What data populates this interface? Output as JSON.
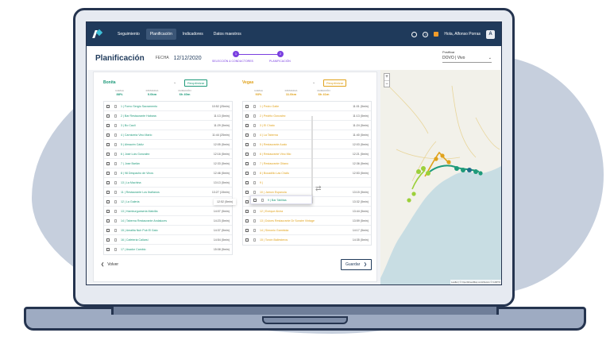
{
  "nav": {
    "tabs": [
      {
        "label": "Seguimiento"
      },
      {
        "label": "Planificación"
      },
      {
        "label": "Indicadores"
      },
      {
        "label": "Datos maestros"
      }
    ],
    "greeting": "Hola,",
    "user_name": "Alfonso Porras",
    "avatar_initial": "A"
  },
  "header": {
    "title": "Planificación",
    "fecha_label": "FECHA",
    "fecha_value": "12/12/2020",
    "steps": [
      {
        "number": "1",
        "label": "SELECCIÓN & CONDUCTORES"
      },
      {
        "number": "2",
        "label": "PLANIFICACIÓN"
      }
    ],
    "postfix_label": "Postfixar",
    "postfix_value": "DOVO | Vivo"
  },
  "left": {
    "name": "Bonita",
    "assign_label": "Reoptimizar",
    "stats": [
      {
        "label": "CARGA",
        "value": "88%"
      },
      {
        "label": "DISTANCIA",
        "value": "0.0km"
      },
      {
        "label": "DURACIÓN",
        "value": "6h 40m"
      }
    ],
    "rows": [
      {
        "name": "1 | Forno Sergio Sacramento",
        "time": "10:52 (25min)"
      },
      {
        "name": "2 | Bar Restaurante Habana",
        "time": "11:13 (5min)"
      },
      {
        "name": "3 | Bo Caoli",
        "time": "11:29 (5min)"
      },
      {
        "name": "4 | Carniceria Vino Marlo",
        "time": "11:44 (25min)"
      },
      {
        "name": "5 | Almacén Cádiz",
        "time": "12:05 (5min)"
      },
      {
        "name": "6 | José Luis Gonzalez",
        "time": "12:16 (5min)"
      },
      {
        "name": "7 | Jose Barlán",
        "time": "12:33 (5min)"
      },
      {
        "name": "8 | 98 Despacho de Vinos",
        "time": "12:46 (5min)"
      },
      {
        "name": "13 | La Machina",
        "time": "13:13 (5min)"
      },
      {
        "name": "11 | Restaurante Los Ibañanos",
        "time": "13:27 (15min)"
      },
      {
        "name": "12 | La Galeria",
        "time": "13:52 (5min)"
      },
      {
        "name": "13 | Hamburgueseria Malvilla",
        "time": "14:07 (5min)"
      },
      {
        "name": "14 | Taberna Restaurante Andaluces",
        "time": "14:23 (5min)"
      },
      {
        "name": "15 | Amaltia Nuh Pub El Gato",
        "time": "14:37 (5min)"
      },
      {
        "name": "16 | Cafeteria Caliarsi",
        "time": "14:54 (5min)"
      },
      {
        "name": "17 | Asador Cambio",
        "time": "15:08 (5min)"
      }
    ]
  },
  "right": {
    "name": "Vegas",
    "assign_label": "Reoptimizar",
    "stats": [
      {
        "label": "CARGA",
        "value": "93%"
      },
      {
        "label": "DISTANCIA",
        "value": "11.0km"
      },
      {
        "label": "DURACIÓN",
        "value": "6h 41m"
      }
    ],
    "rows": [
      {
        "name": "1 | Pedro Gaite",
        "time": "11:01 (5min)"
      },
      {
        "name": "2 | Pedrito Gonzalez",
        "time": "11:13 (5min)"
      },
      {
        "name": "3 | El Chato",
        "time": "11:24 (5min)"
      },
      {
        "name": "4 | La Taberna",
        "time": "11:40 (5min)"
      },
      {
        "name": "5 | Restaurante Acalo",
        "time": "12:03 (5min)"
      },
      {
        "name": "6 | Restaurante Vino Mio",
        "time": "12:21 (5min)"
      },
      {
        "name": "7 | Restaurante Gitano",
        "time": "12:36 (5min)"
      },
      {
        "name": "8 | Bocadillo Las Chafu",
        "time": "12:53 (5min)"
      },
      {
        "name": "9 | ",
        "time": ""
      },
      {
        "name": "10 | Jamon Espanola",
        "time": "13:15 (5min)"
      },
      {
        "name": "11 | Olivo Dorado",
        "time": "13:32 (5min)"
      },
      {
        "name": "12 | Enrique Alvira",
        "time": "13:44 (5min)"
      },
      {
        "name": "13 | Dulces Restaurante Dr Soraire Vintage",
        "time": "13:59 (5min)"
      },
      {
        "name": "14 | Simonio Gambiola",
        "time": "14:17 (5min)"
      },
      {
        "name": "15 | Torcin Ballesteros",
        "time": "14:35 (5min)"
      }
    ]
  },
  "drag": {
    "name": "9 | Bar Tablitas",
    "time": "12:52 (5min)"
  },
  "footer": {
    "back_label": "Volver",
    "save_label": "Guardar"
  },
  "map": {
    "zoom_in": "+",
    "zoom_out": "−",
    "attribution": "Leaflet | © OpenStreetMap contributors © CARTO",
    "colors": {
      "route_left": "#1e9a7a",
      "route_right": "#e0a21b",
      "route_other": "#9cd03a"
    }
  }
}
